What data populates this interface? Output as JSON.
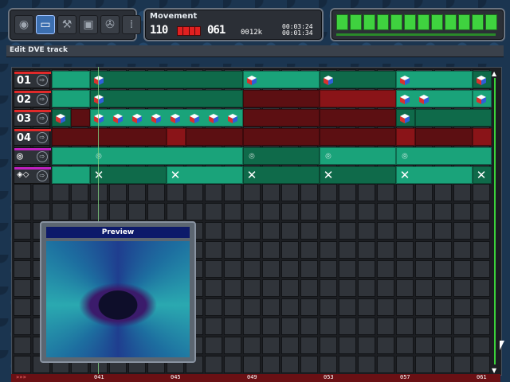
{
  "toolbar": {
    "tools": [
      {
        "icon": "globe-icon",
        "glyph": "◉"
      },
      {
        "icon": "monitor-icon",
        "glyph": "▭",
        "active": true
      },
      {
        "icon": "tools-icon",
        "glyph": "⚒"
      },
      {
        "icon": "floppy-disk-icon",
        "glyph": "▣"
      },
      {
        "icon": "film-reel-icon",
        "glyph": "✇"
      },
      {
        "icon": "grid-dots-icon",
        "glyph": "⁞"
      }
    ]
  },
  "info": {
    "title": "Movement",
    "bpm": "110",
    "position": "061",
    "size": "0012k",
    "time_elapsed": "00:03:24",
    "time_total": "00:01:34"
  },
  "header": {
    "title": "Edit DVE track"
  },
  "tracks": [
    {
      "label": "01",
      "strip": "#e02a2a"
    },
    {
      "label": "02",
      "strip": "#e02a2a"
    },
    {
      "label": "03",
      "strip": "#e02a2a"
    },
    {
      "label": "04",
      "strip": "#e02a2a"
    },
    {
      "label": "",
      "strip": "#c020c0",
      "icon": "camera-icon"
    },
    {
      "label": "",
      "strip": "#c020c0",
      "icon": "transition-icon"
    }
  ],
  "preview": {
    "title": "Preview"
  },
  "timeline": {
    "ticks": [
      "041",
      "045",
      "049",
      "053",
      "057",
      "061"
    ]
  },
  "colors": {
    "green_light": "#1aa37a",
    "green_dark": "#0f6a4a",
    "red_dark": "#5c0f12",
    "red_light": "#8a1418"
  }
}
